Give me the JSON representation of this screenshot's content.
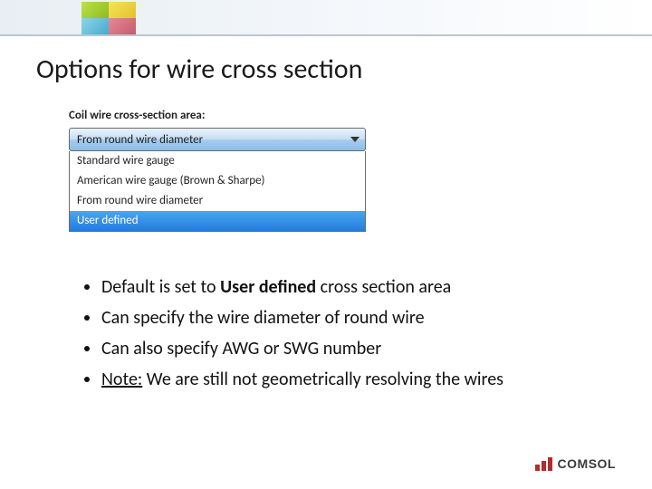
{
  "header": {
    "title": "Options for wire cross section"
  },
  "widget": {
    "label": "Coil wire cross-section area:",
    "selected": "From round wire diameter",
    "options": [
      "Standard wire gauge",
      "American wire gauge (Brown & Sharpe)",
      "From round wire diameter",
      "User defined"
    ]
  },
  "bullets": {
    "items": [
      {
        "pre": "Default is set to ",
        "bold": "User defined",
        "post": " cross section area"
      },
      {
        "text": "Can specify the wire diameter of round wire"
      },
      {
        "text": "Can also specify AWG or SWG number"
      },
      {
        "note_label": "Note:",
        "note_text": " We are still not geometrically resolving the wires"
      }
    ]
  },
  "footer": {
    "brand": "COMSOL"
  }
}
